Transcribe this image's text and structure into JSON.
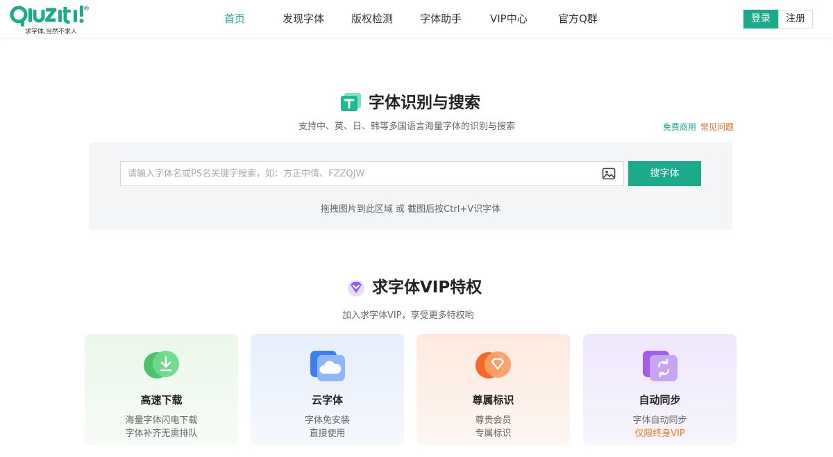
{
  "header": {
    "logo_text": "QIUZITI",
    "logo_reg": "®",
    "logo_tagline": "求字体,当然不求人",
    "nav": [
      {
        "label": "首页",
        "active": true
      },
      {
        "label": "发现字体"
      },
      {
        "label": "版权检测"
      },
      {
        "label": "字体助手"
      },
      {
        "label": "VIP中心"
      },
      {
        "label": "官方Q群"
      }
    ],
    "login_label": "登录",
    "register_label": "注册"
  },
  "search_section": {
    "icon": "font-t-icon",
    "title": "字体识别与搜索",
    "subtitle": "支持中、英、日、韩等多国语言海量字体的识别与搜索",
    "link_free": "免费商用",
    "link_faq": "常见问题",
    "input_placeholder": "请输入字体名或PS名关键字搜索，如：方正中倩、FZZQJW",
    "image_icon": "image-upload-icon",
    "search_button": "搜字体",
    "drag_hint": "拖拽图片到此区域 或 截图后按Ctrl+V识字体"
  },
  "vip_section": {
    "icon": "vip-diamond-icon",
    "title": "求字体VIP特权",
    "subtitle": "加入求字体VIP，享受更多特权哟",
    "cards": [
      {
        "icon": "download-icon",
        "title": "高速下载",
        "line1": "海量字体闪电下载",
        "line2": "字体补齐无需排队"
      },
      {
        "icon": "cloud-icon",
        "title": "云字体",
        "line1": "字体免安装",
        "line2": "直接使用"
      },
      {
        "icon": "badge-icon",
        "title": "尊属标识",
        "line1": "尊贵会员",
        "line2": "专属标识"
      },
      {
        "icon": "sync-icon",
        "title": "自动同步",
        "line1": "字体自动同步",
        "line2": "仅限终身VIP"
      }
    ]
  },
  "colors": {
    "brand": "#1aaa8c",
    "accent_orange": "#e67a1a",
    "vip_purple": "#8b5cf6"
  }
}
